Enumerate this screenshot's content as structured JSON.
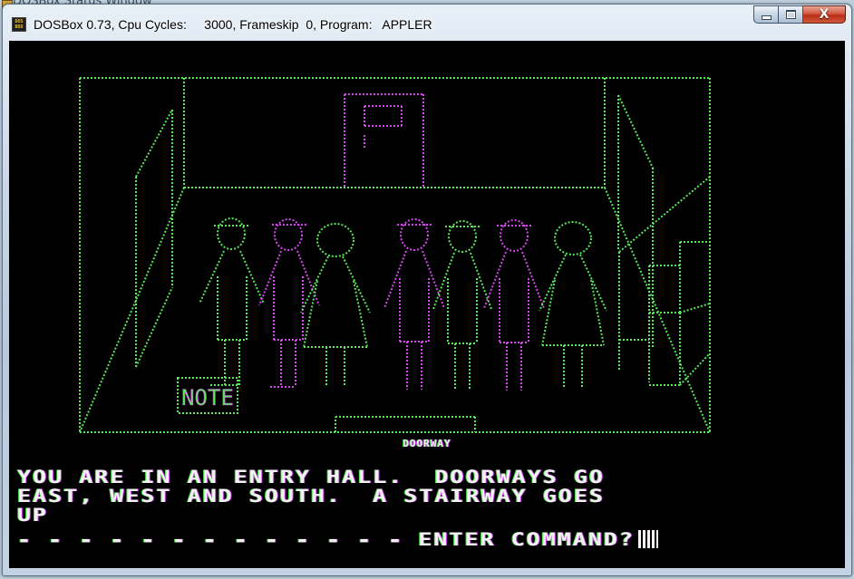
{
  "window": {
    "title": "DOSBox 0.73, Cpu Cycles:     3000, Frameskip  0, Program:   APPLER",
    "icon_name": "dosbox-icon",
    "icon_text_line1": "DOS",
    "icon_text_line2": "BOX",
    "behind_window_title": "DOSBox Status Window"
  },
  "caption_buttons": {
    "minimize_icon": "minimize-icon",
    "maximize_icon": "maximize-icon",
    "close_icon": "close-icon",
    "close_glyph": "X"
  },
  "game": {
    "note_label": "NOTE",
    "room_label": "DOORWAY",
    "description_lines": [
      "YOU ARE IN AN ENTRY HALL.  DOORWAYS GO",
      "EAST, WEST AND SOUTH.  A STAIRWAY GOES",
      "UP"
    ],
    "separator": "- - - - - - - - - - - - -",
    "prompt": "ENTER COMMAND?"
  },
  "colors": {
    "screen_background": "#000000",
    "line_green": "#58e858",
    "line_magenta": "#d848f0",
    "text_white": "#f4f0f4"
  }
}
